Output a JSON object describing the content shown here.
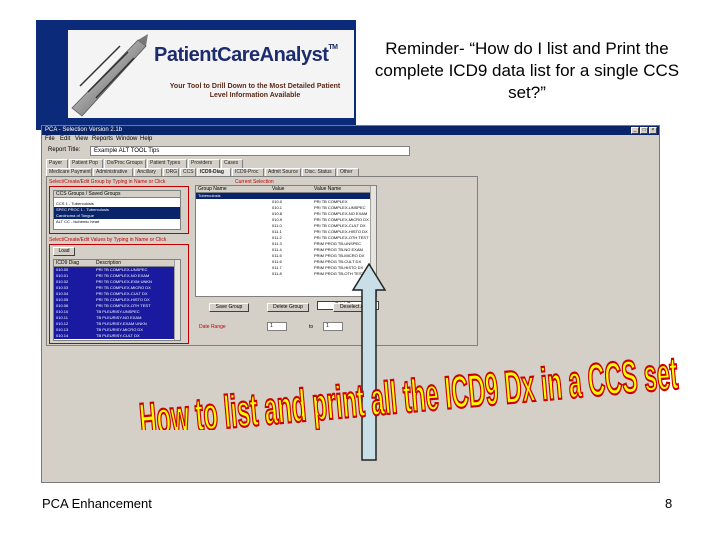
{
  "logo": {
    "name": "PatientCareAnalyst",
    "trademark": "TM",
    "tagline": "Your Tool to Drill Down to the Most Detailed Patient Level Information Available"
  },
  "reminder": "Reminder- “How do I list and Print the complete ICD9 data list for a single CCS set?”",
  "app": {
    "window_title": "PCA - Selection Version 2.1b",
    "menu": [
      "File",
      "Edit",
      "View",
      "Reports",
      "Window",
      "Help"
    ],
    "report_title_label": "Report Title:",
    "report_title_value": "Example ALT TOOL Tips",
    "tabs_row1": [
      "Payer",
      "Patient Pop",
      "Dx/Proc Groups",
      "Patient Types",
      "Providers",
      "Cases"
    ],
    "tabs_row2": [
      "Medicare Payment",
      "Administrative",
      "Ancillary",
      "DRG",
      "CCS",
      "ICD9-Diag",
      "ICD9-Proc",
      "Admit Source",
      "Disc. Status",
      "Other"
    ],
    "active_tab": "ICD9-Diag",
    "step1_label": "Select/Create/Edit Group by Typing in Name or Click",
    "current_selection_label": "Current Selection",
    "group_list": [
      "CCS 1 - Tuberculosis",
      "SPEC PROC 1 - Tuberculosis",
      "Carcinoma of Tongue",
      "ALT CC - Ischemic heart"
    ],
    "group_list_header": "CCS Groups / Saved Groups",
    "table_headers": [
      "Group Name",
      "Value",
      "Value Name"
    ],
    "table_first_row": "Tuberculosis",
    "table_values": [
      "010.0",
      "010.1",
      "010.8",
      "010.9",
      "011.0",
      "011.1",
      "011.2",
      "011.3",
      "011.4",
      "011.5",
      "011.6",
      "011.7",
      "011.8"
    ],
    "table_value_names": [
      "PRI TB COMPLEX",
      "PRI TB COMPLEX-UNSPEC",
      "PRI TB COMPLEX-NO EXAM",
      "PRI TB COMPLEX-MICRO DX",
      "PRI TB COMPLEX-CULT DX",
      "PRI TB COMPLEX-HISTO DX",
      "PRI TB COMPLEX-OTH TEST",
      "PRIM PROG TB-UNSPEC",
      "PRIM PROG TB-NO EXAM",
      "PRIM PROG TB-MICRO DX",
      "PRIM PROG TB-CULT DX",
      "PRIM PROG TB-HISTO DX",
      "PRIM PROG TB-OTH TEST"
    ],
    "popup_label": "Print Group",
    "step2_label": "Select/Create/Edit Values by Typing in Name or Click",
    "load_button": "Load",
    "icd_headers": [
      "ICD9 Diag",
      "Description"
    ],
    "icd_codes": [
      "010.00",
      "010.01",
      "010.02",
      "010.03",
      "010.04",
      "010.05",
      "010.06",
      "010.10",
      "010.11",
      "010.12",
      "010.13",
      "010.14"
    ],
    "icd_desc": [
      "PRI TB COMPLEX-UNSPEC",
      "PRI TB COMPLEX-NO EXAM",
      "PRI TB COMPLEX-EXM UNKN",
      "PRI TB COMPLEX-MICRO DX",
      "PRI TB COMPLEX-CULT DX",
      "PRI TB COMPLEX-HISTO DX",
      "PRI TB COMPLEX-OTH TEST",
      "TB PLEURISY-UNSPEC",
      "TB PLEURISY-NO EXAM",
      "TB PLEURISY-EXAM UNKN",
      "TB PLEURISY-MICRO DX",
      "TB PLEURISY-CULT DX"
    ],
    "save_group_button": "Save Group",
    "delete_group_button": "Delete Group",
    "deselect_all_button": "Deselect All",
    "date_label": "Date Range",
    "from_value": "1",
    "to_label": "to",
    "to_value": "1"
  },
  "big_title": "How to list and print all the ICD9 Dx in a CCS set",
  "footer": {
    "left": "PCA Enhancement",
    "page": "8"
  },
  "colors": {
    "title_fill": "#ffff00",
    "title_outline": "#cc0000",
    "arrow_fill": "#c8dfe8",
    "selection": "#0a246a"
  }
}
